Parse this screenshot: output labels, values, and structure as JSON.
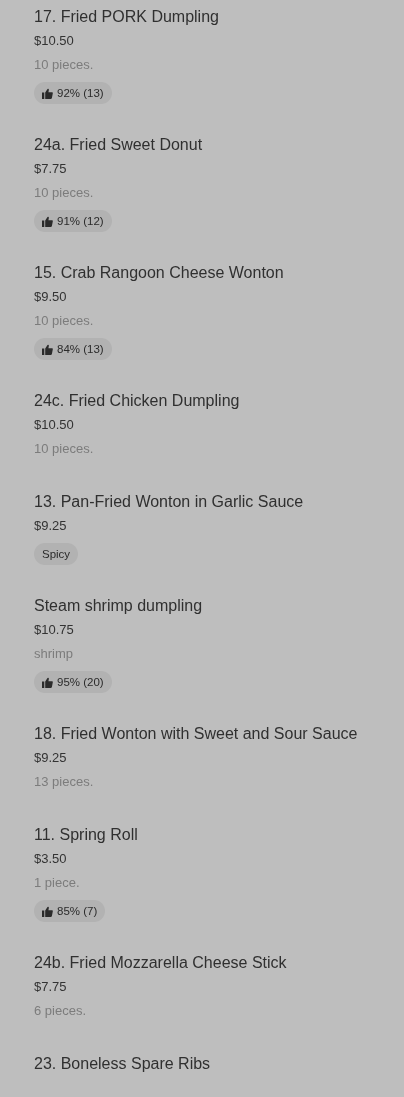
{
  "items": [
    {
      "name": "17. Fried PORK Dumpling",
      "price": "$10.50",
      "description": "10 pieces.",
      "badges": [
        {
          "kind": "rating",
          "text": "92% (13)"
        }
      ]
    },
    {
      "name": "24a. Fried Sweet Donut",
      "price": "$7.75",
      "description": "10 pieces.",
      "badges": [
        {
          "kind": "rating",
          "text": "91% (12)"
        }
      ]
    },
    {
      "name": "15. Crab Rangoon Cheese Wonton",
      "price": "$9.50",
      "description": "10 pieces.",
      "badges": [
        {
          "kind": "rating",
          "text": "84% (13)"
        }
      ]
    },
    {
      "name": "24c. Fried Chicken Dumpling",
      "price": "$10.50",
      "description": "10 pieces."
    },
    {
      "name": "13. Pan-Fried Wonton in Garlic Sauce",
      "price": "$9.25",
      "badges": [
        {
          "kind": "tag",
          "text": "Spicy"
        }
      ]
    },
    {
      "name": "Steam shrimp dumpling",
      "price": "$10.75",
      "description": "shrimp",
      "badges": [
        {
          "kind": "rating",
          "text": "95% (20)"
        }
      ]
    },
    {
      "name": "18. Fried Wonton with Sweet and Sour Sauce",
      "price": "$9.25",
      "description": "13 pieces."
    },
    {
      "name": "11. Spring Roll",
      "price": "$3.50",
      "description": "1 piece.",
      "badges": [
        {
          "kind": "rating",
          "text": "85% (7)"
        }
      ]
    },
    {
      "name": "24b. Fried Mozzarella Cheese Stick",
      "price": "$7.75",
      "description": "6 pieces."
    },
    {
      "name": "23. Boneless Spare Ribs"
    }
  ]
}
